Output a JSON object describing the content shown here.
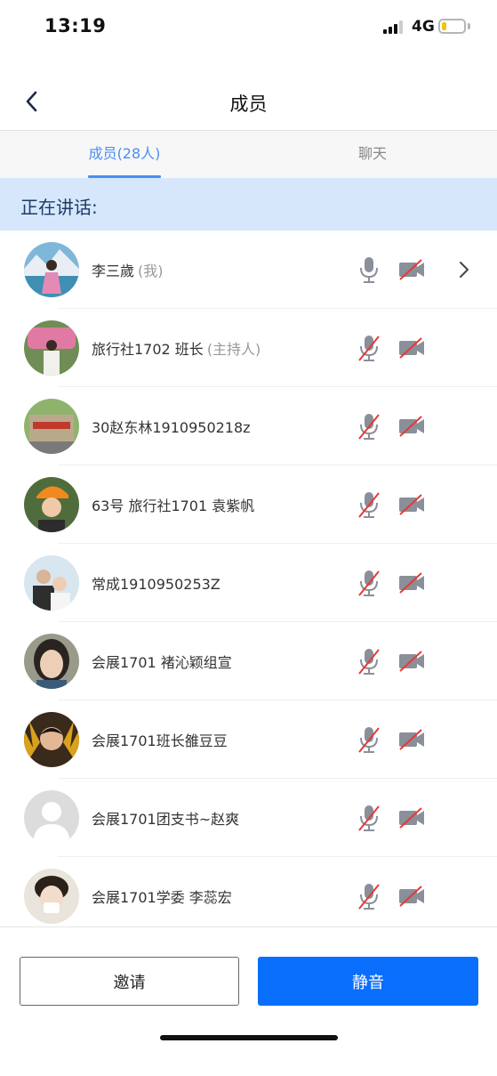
{
  "status_bar": {
    "time": "13:19",
    "network": "4G"
  },
  "nav": {
    "title": "成员",
    "back_icon": "chevron-left-icon"
  },
  "tabs": [
    {
      "label": "成员(28人)",
      "active": true
    },
    {
      "label": "聊天",
      "active": false
    }
  ],
  "speaking": {
    "label": "正在讲话:"
  },
  "members": [
    {
      "name": "李三歲",
      "tag": "(我)",
      "mic_muted": false,
      "camera_off": true,
      "has_chevron": true
    },
    {
      "name": "旅行社1702 班长",
      "tag": "(主持人)",
      "mic_muted": true,
      "camera_off": true,
      "has_chevron": false
    },
    {
      "name": "30赵东林1910950218z",
      "tag": "",
      "mic_muted": true,
      "camera_off": true,
      "has_chevron": false
    },
    {
      "name": "63号 旅行社1701 袁紫帆",
      "tag": "",
      "mic_muted": true,
      "camera_off": true,
      "has_chevron": false
    },
    {
      "name": "常成1910950253Z",
      "tag": "",
      "mic_muted": true,
      "camera_off": true,
      "has_chevron": false
    },
    {
      "name": "会展1701 褚沁颖组宣",
      "tag": "",
      "mic_muted": true,
      "camera_off": true,
      "has_chevron": false
    },
    {
      "name": "会展1701班长雒豆豆",
      "tag": "",
      "mic_muted": true,
      "camera_off": true,
      "has_chevron": false
    },
    {
      "name": "会展1701团支书~赵爽",
      "tag": "",
      "mic_muted": true,
      "camera_off": true,
      "has_chevron": false
    },
    {
      "name": "会展1701学委 李蕊宏",
      "tag": "",
      "mic_muted": true,
      "camera_off": true,
      "has_chevron": false
    }
  ],
  "buttons": {
    "invite": "邀请",
    "mute": "静音"
  },
  "colors": {
    "accent": "#0a6efd",
    "tab_active": "#4a8ef0",
    "speaking_bg": "#d6e7fc",
    "muted_slash": "#e53935"
  }
}
